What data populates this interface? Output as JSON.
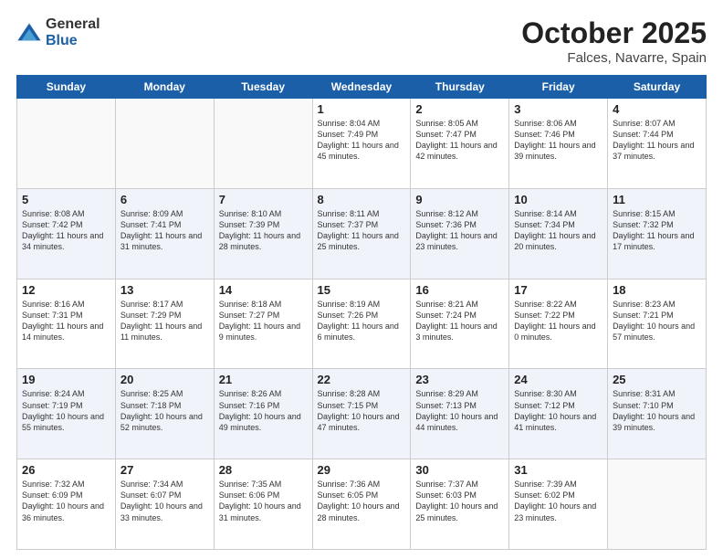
{
  "header": {
    "logo_general": "General",
    "logo_blue": "Blue",
    "month": "October 2025",
    "location": "Falces, Navarre, Spain"
  },
  "days_of_week": [
    "Sunday",
    "Monday",
    "Tuesday",
    "Wednesday",
    "Thursday",
    "Friday",
    "Saturday"
  ],
  "weeks": [
    [
      {
        "day": "",
        "info": ""
      },
      {
        "day": "",
        "info": ""
      },
      {
        "day": "",
        "info": ""
      },
      {
        "day": "1",
        "info": "Sunrise: 8:04 AM\nSunset: 7:49 PM\nDaylight: 11 hours\nand 45 minutes."
      },
      {
        "day": "2",
        "info": "Sunrise: 8:05 AM\nSunset: 7:47 PM\nDaylight: 11 hours\nand 42 minutes."
      },
      {
        "day": "3",
        "info": "Sunrise: 8:06 AM\nSunset: 7:46 PM\nDaylight: 11 hours\nand 39 minutes."
      },
      {
        "day": "4",
        "info": "Sunrise: 8:07 AM\nSunset: 7:44 PM\nDaylight: 11 hours\nand 37 minutes."
      }
    ],
    [
      {
        "day": "5",
        "info": "Sunrise: 8:08 AM\nSunset: 7:42 PM\nDaylight: 11 hours\nand 34 minutes."
      },
      {
        "day": "6",
        "info": "Sunrise: 8:09 AM\nSunset: 7:41 PM\nDaylight: 11 hours\nand 31 minutes."
      },
      {
        "day": "7",
        "info": "Sunrise: 8:10 AM\nSunset: 7:39 PM\nDaylight: 11 hours\nand 28 minutes."
      },
      {
        "day": "8",
        "info": "Sunrise: 8:11 AM\nSunset: 7:37 PM\nDaylight: 11 hours\nand 25 minutes."
      },
      {
        "day": "9",
        "info": "Sunrise: 8:12 AM\nSunset: 7:36 PM\nDaylight: 11 hours\nand 23 minutes."
      },
      {
        "day": "10",
        "info": "Sunrise: 8:14 AM\nSunset: 7:34 PM\nDaylight: 11 hours\nand 20 minutes."
      },
      {
        "day": "11",
        "info": "Sunrise: 8:15 AM\nSunset: 7:32 PM\nDaylight: 11 hours\nand 17 minutes."
      }
    ],
    [
      {
        "day": "12",
        "info": "Sunrise: 8:16 AM\nSunset: 7:31 PM\nDaylight: 11 hours\nand 14 minutes."
      },
      {
        "day": "13",
        "info": "Sunrise: 8:17 AM\nSunset: 7:29 PM\nDaylight: 11 hours\nand 11 minutes."
      },
      {
        "day": "14",
        "info": "Sunrise: 8:18 AM\nSunset: 7:27 PM\nDaylight: 11 hours\nand 9 minutes."
      },
      {
        "day": "15",
        "info": "Sunrise: 8:19 AM\nSunset: 7:26 PM\nDaylight: 11 hours\nand 6 minutes."
      },
      {
        "day": "16",
        "info": "Sunrise: 8:21 AM\nSunset: 7:24 PM\nDaylight: 11 hours\nand 3 minutes."
      },
      {
        "day": "17",
        "info": "Sunrise: 8:22 AM\nSunset: 7:22 PM\nDaylight: 11 hours\nand 0 minutes."
      },
      {
        "day": "18",
        "info": "Sunrise: 8:23 AM\nSunset: 7:21 PM\nDaylight: 10 hours\nand 57 minutes."
      }
    ],
    [
      {
        "day": "19",
        "info": "Sunrise: 8:24 AM\nSunset: 7:19 PM\nDaylight: 10 hours\nand 55 minutes."
      },
      {
        "day": "20",
        "info": "Sunrise: 8:25 AM\nSunset: 7:18 PM\nDaylight: 10 hours\nand 52 minutes."
      },
      {
        "day": "21",
        "info": "Sunrise: 8:26 AM\nSunset: 7:16 PM\nDaylight: 10 hours\nand 49 minutes."
      },
      {
        "day": "22",
        "info": "Sunrise: 8:28 AM\nSunset: 7:15 PM\nDaylight: 10 hours\nand 47 minutes."
      },
      {
        "day": "23",
        "info": "Sunrise: 8:29 AM\nSunset: 7:13 PM\nDaylight: 10 hours\nand 44 minutes."
      },
      {
        "day": "24",
        "info": "Sunrise: 8:30 AM\nSunset: 7:12 PM\nDaylight: 10 hours\nand 41 minutes."
      },
      {
        "day": "25",
        "info": "Sunrise: 8:31 AM\nSunset: 7:10 PM\nDaylight: 10 hours\nand 39 minutes."
      }
    ],
    [
      {
        "day": "26",
        "info": "Sunrise: 7:32 AM\nSunset: 6:09 PM\nDaylight: 10 hours\nand 36 minutes."
      },
      {
        "day": "27",
        "info": "Sunrise: 7:34 AM\nSunset: 6:07 PM\nDaylight: 10 hours\nand 33 minutes."
      },
      {
        "day": "28",
        "info": "Sunrise: 7:35 AM\nSunset: 6:06 PM\nDaylight: 10 hours\nand 31 minutes."
      },
      {
        "day": "29",
        "info": "Sunrise: 7:36 AM\nSunset: 6:05 PM\nDaylight: 10 hours\nand 28 minutes."
      },
      {
        "day": "30",
        "info": "Sunrise: 7:37 AM\nSunset: 6:03 PM\nDaylight: 10 hours\nand 25 minutes."
      },
      {
        "day": "31",
        "info": "Sunrise: 7:39 AM\nSunset: 6:02 PM\nDaylight: 10 hours\nand 23 minutes."
      },
      {
        "day": "",
        "info": ""
      }
    ]
  ]
}
